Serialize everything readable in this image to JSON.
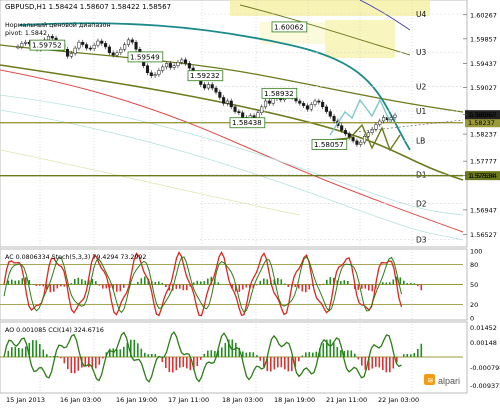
{
  "chart_data": [
    {
      "type": "line",
      "panel": "price",
      "symbol_line": "GBPUSD,H1  1.58424  1.58607  1.58422  1.58567",
      "pivot_note_line1": "Нормальный ценовой диапазон",
      "pivot_note_line2": "pivot: 1.5842",
      "y_ticks": [
        "1.60267",
        "1.59857",
        "1.59437",
        "1.59027",
        "1.58567",
        "1.58237",
        "1.57777",
        "1.57534",
        "1.56947",
        "1.56527"
      ],
      "ylim": [
        1.5635,
        1.6045
      ],
      "x_labels": [
        "15 Jan 2013",
        "16 Jan 03:00",
        "16 Jan 19:00",
        "17 Jan 11:00",
        "18 Jan 03:00",
        "18 Jan 19:00",
        "21 Jan 11:00",
        "22 Jan 03:00"
      ],
      "current_price": "1.58567",
      "price_tags": [
        {
          "text": "1.60062",
          "v": 1.6006,
          "x": 272
        },
        {
          "text": "1.59752",
          "v": 1.5975,
          "x": 30
        },
        {
          "text": "1.59549",
          "v": 1.5955,
          "x": 128
        },
        {
          "text": "1.59232",
          "v": 1.5923,
          "x": 188
        },
        {
          "text": "1.58932",
          "v": 1.5893,
          "x": 262
        },
        {
          "text": "1.58438",
          "v": 1.5843,
          "x": 230
        },
        {
          "text": "1.58057",
          "v": 1.5806,
          "x": 312
        }
      ],
      "levels": [
        {
          "name": "U4",
          "v": 1.6028
        },
        {
          "name": "U3",
          "v": 1.5963
        },
        {
          "name": "U2",
          "v": 1.5905
        },
        {
          "name": "U1",
          "v": 1.5863
        },
        {
          "name": "LB",
          "v": 1.5813
        },
        {
          "name": "D1",
          "v": 1.5755
        },
        {
          "name": "D2",
          "v": 1.5706
        },
        {
          "name": "D3",
          "v": 1.5644
        }
      ],
      "hlines": [
        {
          "v": 1.5843,
          "label": "1.58237",
          "color": "#9a9a3a"
        },
        {
          "v": 1.5753,
          "label": "1.57534",
          "color": "#6d7a1c"
        }
      ],
      "series": [
        {
          "values": [
            1.5972,
            1.5978,
            1.598,
            1.5977,
            1.597,
            1.5968,
            1.5975,
            1.5984,
            1.599,
            1.5987,
            1.598,
            1.5976,
            1.5968,
            1.5956,
            1.5961,
            1.597,
            1.598,
            1.5976,
            1.597,
            1.5969,
            1.5975,
            1.5982,
            1.5978,
            1.5972,
            1.5962,
            1.5958,
            1.5962,
            1.5968,
            1.5976,
            1.5984,
            1.598,
            1.5968,
            1.5957,
            1.594,
            1.5928,
            1.5923,
            1.5925,
            1.5932,
            1.5938,
            1.5944,
            1.5937,
            1.594,
            1.5946,
            1.595,
            1.5944,
            1.5936,
            1.5925,
            1.5918,
            1.5908,
            1.5902,
            1.5908,
            1.5902,
            1.5895,
            1.5886,
            1.5876,
            1.588,
            1.587,
            1.5862,
            1.586,
            1.5852,
            1.5846,
            1.5855,
            1.585,
            1.586,
            1.587,
            1.588,
            1.5876,
            1.5884,
            1.589,
            1.5882,
            1.5888,
            1.5893,
            1.5886,
            1.588,
            1.5876,
            1.5872,
            1.5866,
            1.5874,
            1.588,
            1.5878,
            1.587,
            1.5862,
            1.5854,
            1.5846,
            1.5838,
            1.583,
            1.5824,
            1.5818,
            1.5812,
            1.5806,
            1.581,
            1.582,
            1.5826,
            1.5832,
            1.584,
            1.5846,
            1.5852,
            1.5848,
            1.5852,
            1.5856
          ]
        }
      ]
    },
    {
      "type": "line",
      "panel": "stochastic",
      "legend": "AC  0.0806334   Stoch(5,3,3)  79.4294  73.2992",
      "y_ticks": [
        "100",
        "80",
        "50",
        "20",
        "0"
      ],
      "ylim": [
        0,
        100
      ]
    },
    {
      "type": "line",
      "panel": "cci",
      "legend": "AO  0.001085   CCI(14)  324.6716",
      "y_ticks": [
        "0.01452",
        "0.00148",
        "-0.000798",
        "-0.009375"
      ]
    }
  ],
  "colors": {
    "price_line": "#2b2b2b",
    "teal_ma": "#1b8a8a",
    "olive_ma": "#6d7a1c",
    "red_ma": "#e04c4c",
    "stoch_main": "#e0261c",
    "stoch_signal": "#2d7d18",
    "cci_line": "#2d7d18",
    "hist_pos": "#1f8f1f",
    "hist_neg": "#e03030"
  },
  "brand": "alpari"
}
